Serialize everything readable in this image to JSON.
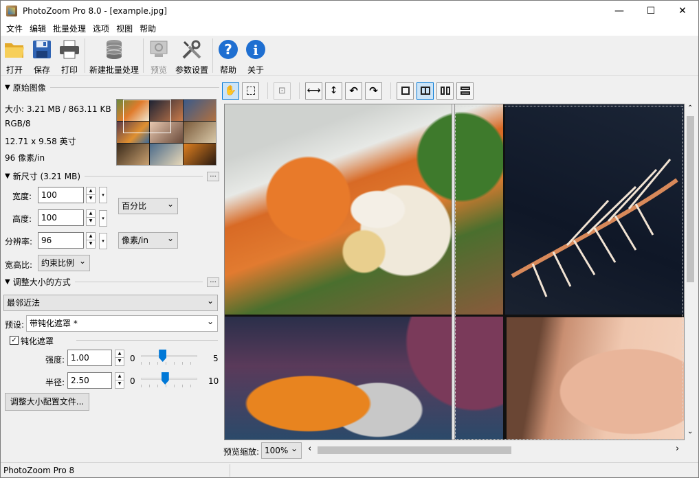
{
  "window": {
    "title": "PhotoZoom Pro 8.0 - [example.jpg]",
    "minimize": "—",
    "maximize": "☐",
    "close": "✕"
  },
  "menu": [
    "文件",
    "编辑",
    "批量处理",
    "选项",
    "视图",
    "帮助"
  ],
  "toolbar": {
    "open": "打开",
    "save": "保存",
    "print": "打印",
    "new_batch": "新建批量处理",
    "preview": "预览",
    "settings": "参数设置",
    "help": "帮助",
    "about": "关于"
  },
  "original": {
    "header": "原始图像",
    "size": "大小: 3.21 MB / 863.11 KB",
    "mode": "RGB/8",
    "dimensions": "12.71 x 9.58 英寸",
    "resolution": "96 像素/in"
  },
  "new_size": {
    "header": "新尺寸 (3.21 MB)",
    "width_label": "宽度:",
    "width_value": "100",
    "height_label": "高度:",
    "height_value": "100",
    "resolution_label": "分辨率:",
    "resolution_value": "96",
    "unit": "百分比",
    "res_unit": "像素/in",
    "aspect_label": "宽高比:",
    "aspect_value": "约束比例"
  },
  "resize_method": {
    "header": "调整大小的方式",
    "method": "最邻近法",
    "preset_label": "预设:",
    "preset_value": "带钝化遮罩 *",
    "unsharp_label": "钝化遮罩",
    "unsharp_checked": "✓",
    "strength_label": "强度:",
    "strength_value": "1.00",
    "strength_min": "0",
    "strength_max": "5",
    "strength_fraction": 0.2,
    "radius_label": "半径:",
    "radius_value": "2.50",
    "radius_min": "0",
    "radius_max": "10",
    "radius_fraction": 0.25,
    "profile_button": "调整大小配置文件..."
  },
  "dots_label": "...",
  "zoom": {
    "label": "预览缩放:",
    "value": "100%"
  },
  "status": {
    "text": "PhotoZoom Pro 8"
  },
  "scroll": {
    "up": "⌃",
    "down": "⌄",
    "left": "‹",
    "right": "›"
  }
}
